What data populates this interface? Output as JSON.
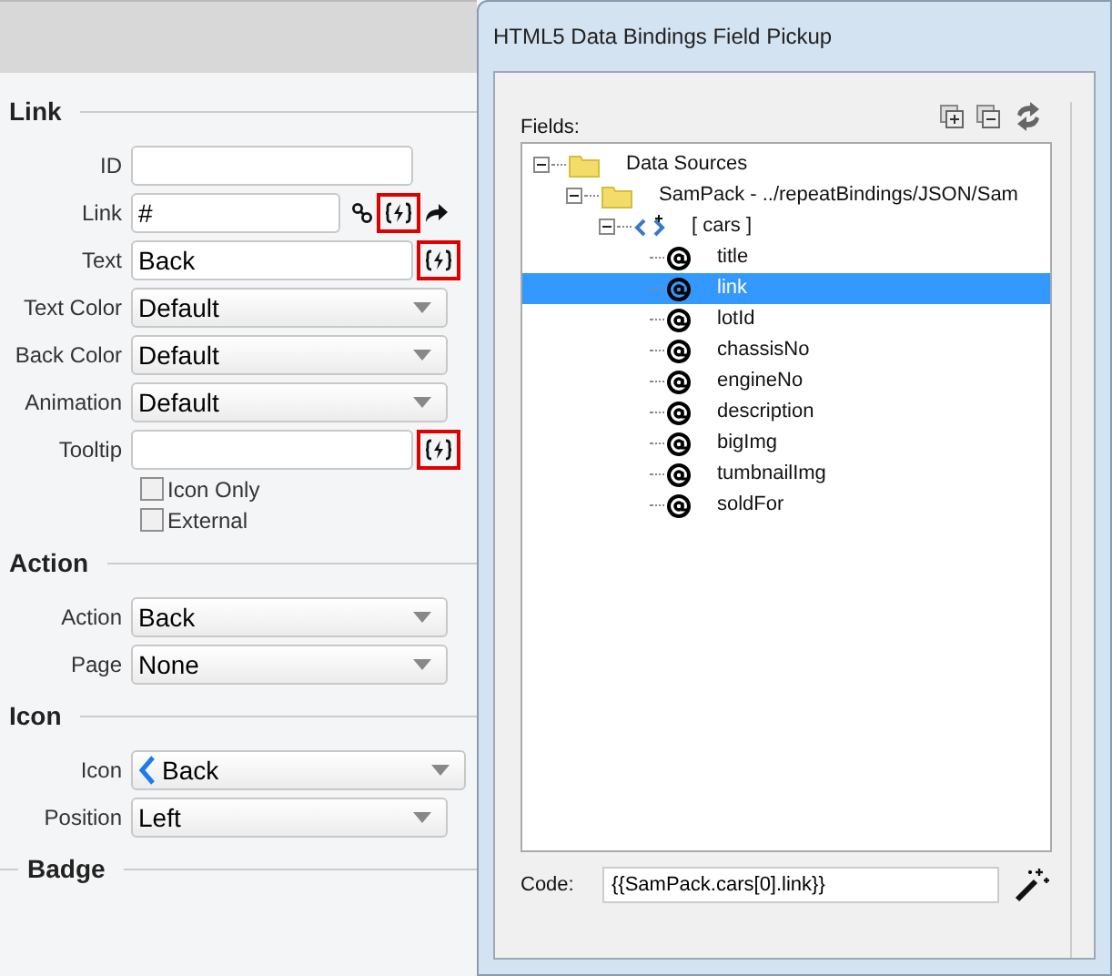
{
  "properties": {
    "sections": [
      {
        "kind": "main",
        "title": "Link",
        "fields": [
          {
            "kind": "text",
            "label": "ID"
          },
          {
            "kind": "link",
            "label": "Link",
            "value": "#",
            "binding": true
          },
          {
            "kind": "text",
            "label": "Text",
            "value": "Back",
            "binding": true
          },
          {
            "kind": "select",
            "label": "Text Color",
            "value": "Default"
          },
          {
            "kind": "select",
            "label": "Back Color",
            "value": "Default"
          },
          {
            "kind": "select",
            "label": "Animation",
            "value": "Default"
          },
          {
            "kind": "text",
            "label": "Tooltip",
            "binding": true
          },
          {
            "kind": "checkbox",
            "label": "Icon Only",
            "checked": false
          },
          {
            "kind": "checkbox",
            "label": "External",
            "checked": false
          }
        ]
      },
      {
        "kind": "main",
        "title": "Action",
        "fields": [
          {
            "kind": "select",
            "label": "Action",
            "value": "Back"
          },
          {
            "kind": "select",
            "label": "Page",
            "value": "None"
          }
        ]
      },
      {
        "kind": "main",
        "title": "Icon",
        "fields": [
          {
            "kind": "icon-select",
            "label": "Icon",
            "value": "Back"
          },
          {
            "kind": "select",
            "label": "Position",
            "value": "Left"
          }
        ]
      },
      {
        "kind": "nested",
        "title": "Badge"
      }
    ]
  },
  "dialog": {
    "title": "HTML5 Data Bindings Field Pickup",
    "fields_label": "Fields:",
    "tree": [
      {
        "kind": "folder",
        "label": "Data Sources",
        "expanded": true,
        "children": [
          {
            "kind": "folder",
            "label": "SamPack - ../repeatBindings/JSON/Sam",
            "expanded": true,
            "children": [
              {
                "kind": "array",
                "label": "[ cars ]",
                "expanded": true,
                "children": [
                  {
                    "kind": "field",
                    "label": "title",
                    "selected": false
                  },
                  {
                    "kind": "field",
                    "label": "link",
                    "selected": true
                  },
                  {
                    "kind": "field",
                    "label": "lotId",
                    "selected": false
                  },
                  {
                    "kind": "field",
                    "label": "chassisNo",
                    "selected": false
                  },
                  {
                    "kind": "field",
                    "label": "engineNo",
                    "selected": false
                  },
                  {
                    "kind": "field",
                    "label": "description",
                    "selected": false
                  },
                  {
                    "kind": "field",
                    "label": "bigImg",
                    "selected": false
                  },
                  {
                    "kind": "field",
                    "label": "tumbnailImg",
                    "selected": false
                  },
                  {
                    "kind": "field",
                    "label": "soldFor",
                    "selected": false
                  }
                ]
              }
            ]
          }
        ]
      }
    ],
    "code_label": "Code:",
    "code_value": "{{SamPack.cars[0].link}}"
  }
}
